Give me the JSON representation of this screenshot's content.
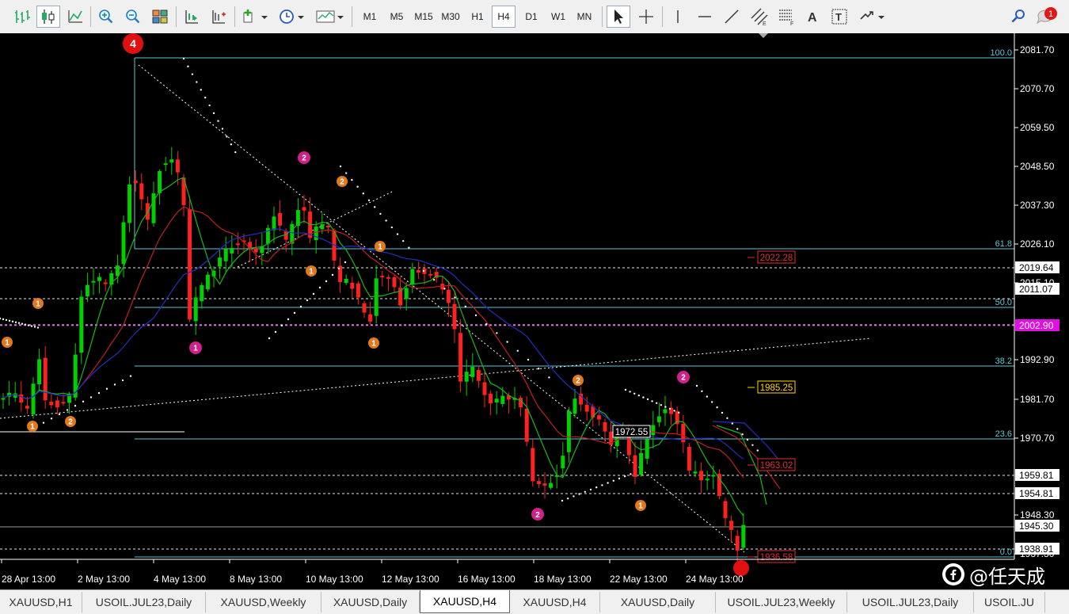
{
  "toolbar": {
    "timeframes": [
      "M1",
      "M5",
      "M15",
      "M30",
      "H1",
      "H4",
      "D1",
      "W1",
      "MN"
    ],
    "active_timeframe": "H4",
    "notification_count": "1",
    "icons": [
      "bar-chart-icon",
      "candlestick-icon",
      "line-chart-icon",
      "zoom-in-icon",
      "zoom-out-icon",
      "tile-windows-icon",
      "autoscroll-icon",
      "chart-shift-icon",
      "indicators-icon",
      "periodicity-icon",
      "templates-icon",
      "cursor-icon",
      "crosshair-icon",
      "vertical-line-icon",
      "horizontal-line-icon",
      "trendline-icon",
      "equidistant-channel-icon",
      "fibonacci-icon",
      "text-icon",
      "text-label-icon",
      "arrows-icon",
      "search-icon",
      "notification-icon"
    ]
  },
  "chart": {
    "symbol": "XAUUSD",
    "timeframe": "H4",
    "price_axis": [
      "2081.70",
      "2070.70",
      "2059.50",
      "2048.50",
      "2037.30",
      "2026.10",
      "2015.10",
      "1992.90",
      "1981.70",
      "1970.70",
      "1948.30",
      "1937.30"
    ],
    "time_axis": [
      "28 Apr 13:00",
      "2 May 13:00",
      "4 May 13:00",
      "8 May 13:00",
      "10 May 13:00",
      "12 May 13:00",
      "16 May 13:00",
      "18 May 13:00",
      "22 May 13:00",
      "24 May 13:00"
    ],
    "price_labels": [
      {
        "text": "2019.64",
        "style": "white"
      },
      {
        "text": "2011.07",
        "style": "white"
      },
      {
        "text": "2002.90",
        "style": "magenta"
      },
      {
        "text": "1959.81",
        "style": "white"
      },
      {
        "text": "1954.81",
        "style": "white"
      },
      {
        "text": "1945.30",
        "style": "white"
      },
      {
        "text": "1938.91",
        "style": "white"
      }
    ],
    "fib_levels": [
      "100.0",
      "61.8",
      "50.0",
      "38.2",
      "23.6",
      "0.0"
    ],
    "price_markers": [
      {
        "text": "2022.28",
        "color": "#e03030"
      },
      {
        "text": "1985.25",
        "color": "#ffd700"
      },
      {
        "text": "1963.02",
        "color": "#e03030"
      },
      {
        "text": "1936.58",
        "color": "#e03030"
      },
      {
        "text": "1972.55",
        "color": "#ffffff"
      }
    ],
    "wave_labels": [
      "4",
      "2",
      "1",
      "1",
      "1",
      "2",
      "1",
      "2",
      "1",
      "1",
      "1",
      "2",
      "1",
      "2"
    ],
    "colors": {
      "background": "#000000",
      "bull": "#00d000",
      "bear": "#ff2020",
      "fib": "#5ac8d8",
      "ma_fast": "#18b818",
      "ma_mid": "#c02020",
      "ma_slow": "#2030c0",
      "magenta": "#e010e0"
    }
  },
  "watermark": {
    "text": "@任天成"
  },
  "tabs": [
    {
      "label": "XAUUSD,H1",
      "active": false
    },
    {
      "label": "USOIL.JUL23,Daily",
      "active": false
    },
    {
      "label": "XAUUSD,Weekly",
      "active": false
    },
    {
      "label": "XAUUSD,Daily",
      "active": false
    },
    {
      "label": "XAUUSD,H4",
      "active": true
    },
    {
      "label": "XAUUSD,H4",
      "active": false
    },
    {
      "label": "XAUUSD,Daily",
      "active": false
    },
    {
      "label": "USOIL.JUL23,Weekly",
      "active": false
    },
    {
      "label": "USOIL.JUL23,Daily",
      "active": false
    },
    {
      "label": "USOIL.JU",
      "active": false
    }
  ]
}
